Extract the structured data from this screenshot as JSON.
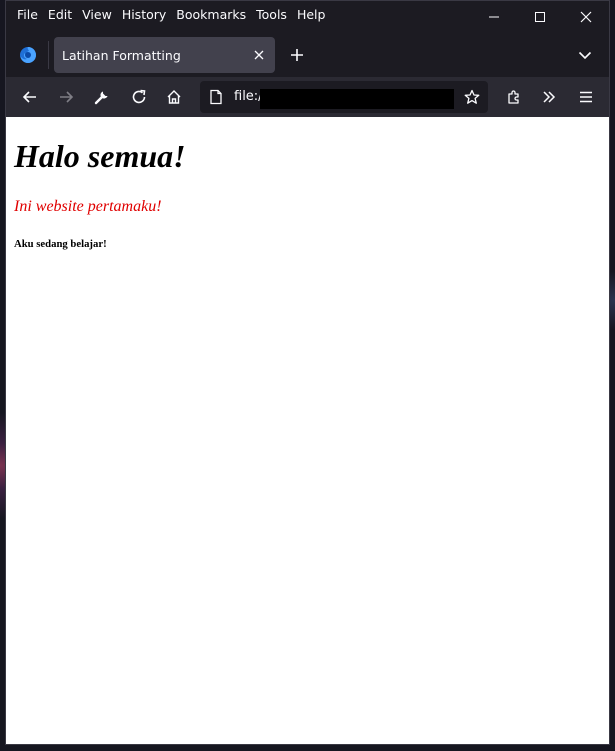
{
  "menu": {
    "file": "File",
    "edit": "Edit",
    "view": "View",
    "history": "History",
    "bookmarks": "Bookmarks",
    "tools": "Tools",
    "help": "Help"
  },
  "tab": {
    "title": "Latihan Formatting"
  },
  "urlbar": {
    "text": "file:/"
  },
  "page": {
    "heading": "Halo semua!",
    "subheading": "Ini website pertamaku!",
    "note": "Aku sedang belajar!",
    "subheading_color": "#e00000"
  },
  "colors": {
    "chrome_bg": "#1c1b22",
    "navbar_bg": "#2b2a33",
    "tab_bg": "#42414d",
    "text": "#fbfbfe"
  },
  "icons": [
    "firefox-logo",
    "minimize-icon",
    "maximize-icon",
    "close-icon",
    "tab-close-icon",
    "plus-icon",
    "chevron-down-icon",
    "back-arrow-icon",
    "forward-arrow-icon",
    "wrench-icon",
    "reload-icon",
    "home-icon",
    "page-icon",
    "star-icon",
    "extensions-icon",
    "overflow-chevrons-icon",
    "hamburger-menu-icon"
  ]
}
